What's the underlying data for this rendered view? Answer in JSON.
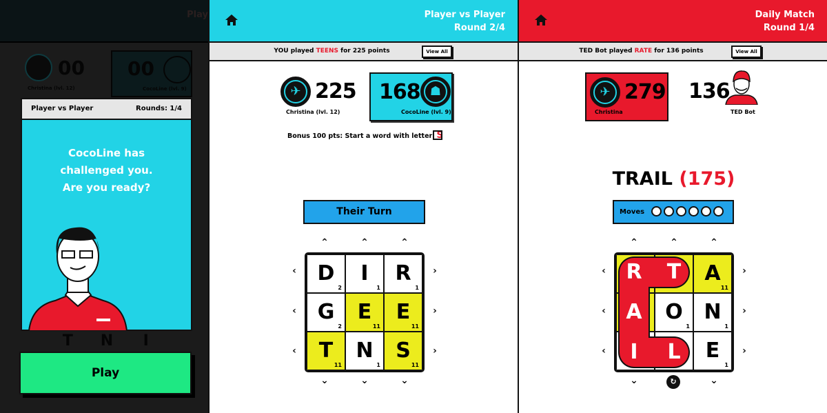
{
  "colors": {
    "cyan": "#22d3e6",
    "red": "#e8192c",
    "yellow": "#ecec1d",
    "green": "#1ee883",
    "blue": "#22a3ea"
  },
  "left": {
    "header_partial": "Play",
    "bg_scores": {
      "p1_score": "00",
      "p1_name": "Christina (lvl. 12)",
      "p2_score": "00",
      "p2_name": "CocoLine (lvl. 9)"
    },
    "modal": {
      "mode": "Player vs Player",
      "rounds": "Rounds: 1/4",
      "message1": "CocoLine has challenged you.",
      "message2": "Are you ready?"
    },
    "bg_tiles": [
      "T",
      "N",
      "I"
    ],
    "play_label": "Play"
  },
  "middle": {
    "header": {
      "mode": "Player vs Player",
      "round": "Round 2/4",
      "icon": "home-icon"
    },
    "last_play": {
      "prefix": "YOU played ",
      "word": "TEENS",
      "suffix": " for 225 points",
      "view_all": "View All"
    },
    "player1": {
      "score": "225",
      "name": "Christina (lvl. 12)",
      "icon": "planet-icon"
    },
    "player2": {
      "score": "168",
      "name": "CocoLine (lvl. 9)",
      "icon": "ghost-icon"
    },
    "bonus": {
      "text": "Bonus 100 pts: Start a word with letter",
      "letter": "S",
      "checked": false
    },
    "turn_label": "Their Turn",
    "grid": [
      {
        "l": "D",
        "n": "2",
        "y": false
      },
      {
        "l": "I",
        "n": "1",
        "y": false
      },
      {
        "l": "R",
        "n": "1",
        "y": false
      },
      {
        "l": "G",
        "n": "2",
        "y": false
      },
      {
        "l": "E",
        "n": "11",
        "y": true
      },
      {
        "l": "E",
        "n": "11",
        "y": true
      },
      {
        "l": "T",
        "n": "11",
        "y": true
      },
      {
        "l": "N",
        "n": "1",
        "y": false
      },
      {
        "l": "S",
        "n": "11",
        "y": true
      }
    ]
  },
  "right": {
    "header": {
      "mode": "Daily Match",
      "round": "Round 1/4",
      "icon": "home-icon"
    },
    "last_play": {
      "prefix": "TED Bot played ",
      "word": "RATE",
      "suffix": " for 136 points",
      "view_all": "View All"
    },
    "player1": {
      "score": "279",
      "name": "Christina",
      "icon": "planet-icon"
    },
    "player2": {
      "score": "136",
      "name": "TED Bot"
    },
    "word": {
      "text": "TRAIL",
      "points": "(175)"
    },
    "moves": {
      "label": "Moves",
      "total": 6,
      "used": 0
    },
    "grid": [
      {
        "l": "R",
        "n": "",
        "y": true,
        "sel": true
      },
      {
        "l": "T",
        "n": "",
        "y": true,
        "sel": true
      },
      {
        "l": "A",
        "n": "11",
        "y": true,
        "sel": false
      },
      {
        "l": "A",
        "n": "",
        "y": true,
        "sel": true
      },
      {
        "l": "O",
        "n": "1",
        "y": false,
        "sel": false
      },
      {
        "l": "N",
        "n": "1",
        "y": false,
        "sel": false
      },
      {
        "l": "I",
        "n": "",
        "y": false,
        "sel": true
      },
      {
        "l": "L",
        "n": "",
        "y": false,
        "sel": true
      },
      {
        "l": "E",
        "n": "1",
        "y": false,
        "sel": false
      }
    ]
  }
}
